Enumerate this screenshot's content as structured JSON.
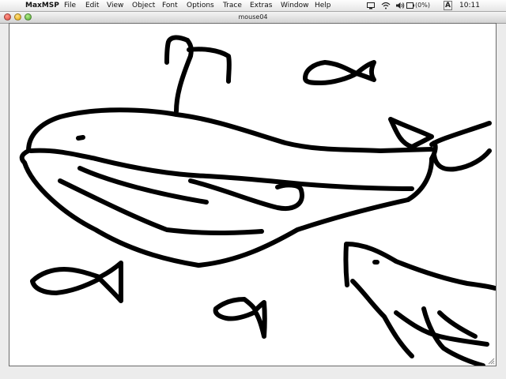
{
  "menubar": {
    "apple_icon": "apple-icon",
    "items": [
      {
        "label": "MaxMSP",
        "bold": true
      },
      {
        "label": "File"
      },
      {
        "label": "Edit"
      },
      {
        "label": "View"
      },
      {
        "label": "Object"
      },
      {
        "label": "Font"
      },
      {
        "label": "Options"
      },
      {
        "label": "Trace"
      },
      {
        "label": "Extras"
      },
      {
        "label": "Window"
      },
      {
        "label": "Help"
      }
    ],
    "status": {
      "battery_label": "(0%)",
      "input_menu": "A",
      "clock": "10:11"
    }
  },
  "window": {
    "title": "mouse04"
  },
  "drawing": {
    "stroke_color": "#000000",
    "background": "#ffffff"
  }
}
